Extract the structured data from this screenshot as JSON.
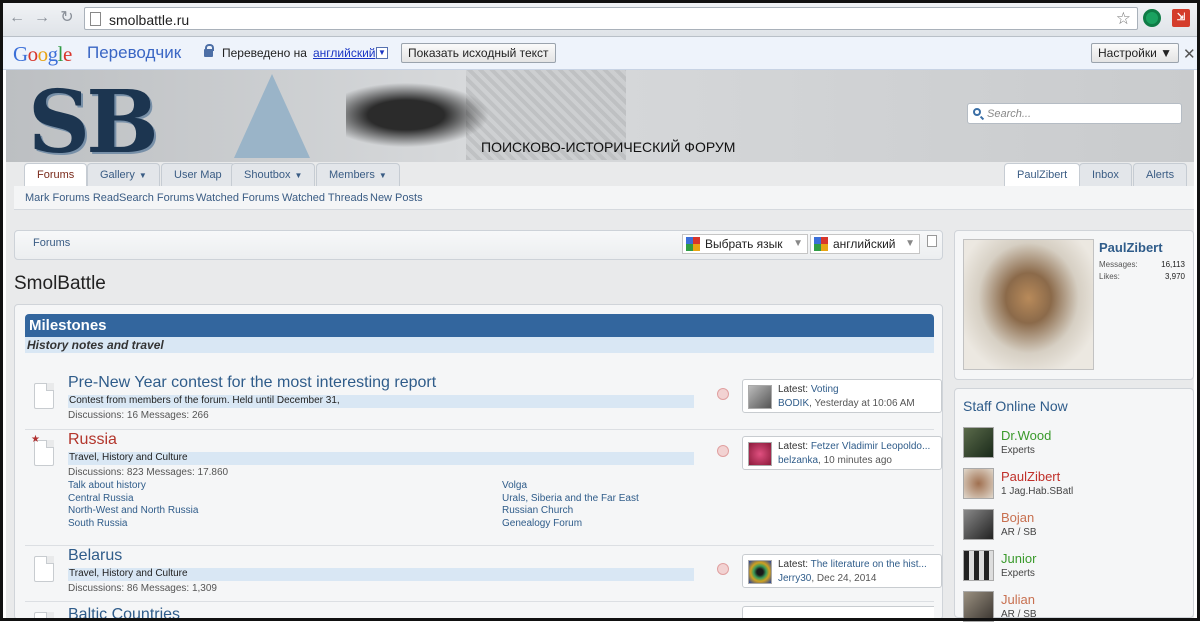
{
  "browser": {
    "url": "smolbattle.ru"
  },
  "translate_bar": {
    "logo_google": "Google",
    "title": "Переводчик",
    "translated_to": "Переведено на",
    "language": "английский",
    "show_original": "Показать исходный текст",
    "settings": "Настройки ▼",
    "close": "✕"
  },
  "header": {
    "logo_text": "SB",
    "forum_title": "ПОИСКОВО-ИСТОРИЧЕСКИЙ ФОРУМ",
    "search_placeholder": "Search..."
  },
  "tabs": {
    "forums": "Forums",
    "gallery": "Gallery",
    "user_map": "User Map",
    "shoutbox": "Shoutbox",
    "members": "Members",
    "user": "PaulZibert",
    "inbox": "Inbox",
    "alerts": "Alerts"
  },
  "subnav": [
    "Mark Forums Read",
    "Search Forums",
    "Watched Forums",
    "Watched Threads",
    "New Posts"
  ],
  "breadcrumb": "Forums",
  "translate_widget": {
    "select_language": "Выбрать язык",
    "language": "английский"
  },
  "page_title": "SmolBattle",
  "category": {
    "title": "Milestones",
    "description": "History notes and travel"
  },
  "nodes": [
    {
      "title": "Pre-New Year contest for the most interesting report",
      "description": "Contest from members of the forum. Held until December 31,",
      "stats": "Discussions: 16 Messages: 266",
      "latest_label": "Latest:",
      "latest_thread": "Voting",
      "latest_user": "BODIK",
      "latest_time": ", Yesterday at 10:06 AM"
    },
    {
      "title": "Russia",
      "description": "Travel, History and Culture",
      "stats": "Discussions: 823 Messages: 17.860",
      "subforums_left": [
        "Talk about history",
        "Central Russia",
        "North-West and North Russia",
        "South Russia"
      ],
      "subforums_right": [
        "Volga",
        "Urals, Siberia and the Far East",
        "Russian Church",
        "Genealogy Forum"
      ],
      "latest_label": "Latest:",
      "latest_thread": "Fetzer Vladimir Leopoldo...",
      "latest_user": "belzanka",
      "latest_time": ", 10 minutes ago"
    },
    {
      "title": "Belarus",
      "description": "Travel, History and Culture",
      "stats": "Discussions: 86 Messages: 1,309",
      "latest_label": "Latest:",
      "latest_thread": "The literature on the hist...",
      "latest_user": "Jerry30",
      "latest_time": ", Dec 24, 2014"
    },
    {
      "title": "Baltic Countries"
    }
  ],
  "visitor": {
    "name": "PaulZibert",
    "messages_label": "Messages:",
    "messages": "16,113",
    "likes_label": "Likes:",
    "likes": "3,970"
  },
  "staff": {
    "title": "Staff Online Now",
    "members": [
      {
        "name": "Dr.Wood",
        "role": "Experts",
        "color": "#3a9a2c"
      },
      {
        "name": "PaulZibert",
        "role": "1 Jag.Hab.SBatl",
        "color": "#c0302a"
      },
      {
        "name": "Bojan",
        "role": "AR / SB",
        "color": "#c87050"
      },
      {
        "name": "Junior",
        "role": "Experts",
        "color": "#3a9a2c"
      },
      {
        "name": "Julian",
        "role": "AR / SB",
        "color": "#c87050"
      }
    ]
  }
}
